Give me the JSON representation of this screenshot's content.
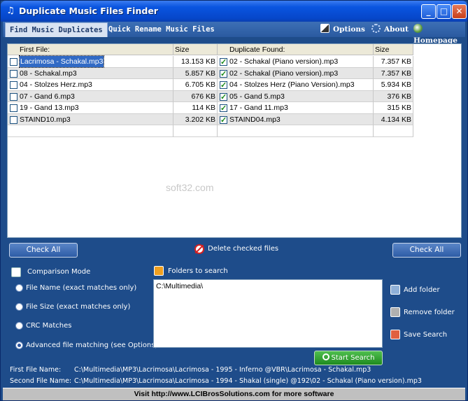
{
  "window": {
    "title": "Duplicate Music Files Finder",
    "controls": [
      "_",
      "□",
      "✕"
    ]
  },
  "tabs": [
    {
      "label": "Find Music Duplicates",
      "active": true
    },
    {
      "label": "Quick Rename Music Files",
      "active": false
    }
  ],
  "menu": {
    "options": "Options",
    "about": "About",
    "homepage": "Homepage"
  },
  "grid": {
    "columns": [
      "First File:",
      "Size",
      "Duplicate Found:",
      "Size"
    ],
    "rows": [
      {
        "first": "Lacrimosa - Schakal.mp3",
        "first_size": "13.153 KB",
        "first_checked": false,
        "dup": "02 - Schakal (Piano version).mp3",
        "dup_size": "7.357 KB",
        "dup_checked": true
      },
      {
        "first": "08 - Schakal.mp3",
        "first_size": "5.857 KB",
        "first_checked": false,
        "dup": "02 - Schakal (Piano version).mp3",
        "dup_size": "7.357 KB",
        "dup_checked": true
      },
      {
        "first": "04 - Stolzes Herz.mp3",
        "first_size": "6.705 KB",
        "first_checked": false,
        "dup": "04 - Stolzes Herz (Piano Version).mp3",
        "dup_size": "5.934 KB",
        "dup_checked": true
      },
      {
        "first": "07 - Gand 6.mp3",
        "first_size": "676 KB",
        "first_checked": false,
        "dup": "05 - Gand 5.mp3",
        "dup_size": "376 KB",
        "dup_checked": true
      },
      {
        "first": "19 - Gand 13.mp3",
        "first_size": "114 KB",
        "first_checked": false,
        "dup": "17 - Gand 11.mp3",
        "dup_size": "315 KB",
        "dup_checked": true
      },
      {
        "first": "STAIND10.mp3",
        "first_size": "3.202 KB",
        "first_checked": false,
        "dup": "STAIND04.mp3",
        "dup_size": "4.134 KB",
        "dup_checked": true
      }
    ],
    "watermark": "soft32.com"
  },
  "actions": {
    "check_all_left": "Check All",
    "delete_checked": "Delete checked files",
    "check_all_right": "Check All"
  },
  "comparison": {
    "title": "Comparison Mode",
    "options": [
      {
        "label": "File Name (exact matches only)",
        "selected": false
      },
      {
        "label": "File Size (exact matches only)",
        "selected": false
      },
      {
        "label": "CRC Matches",
        "selected": false
      },
      {
        "label": "Advanced file matching (see Options)",
        "selected": true
      }
    ]
  },
  "folders": {
    "title": "Folders to search",
    "value": "C:\\Multimedia\\"
  },
  "side_actions": {
    "add_folder": "Add folder",
    "remove_folder": "Remove folder",
    "save_search": "Save Search"
  },
  "start_search": "Start Search",
  "info": {
    "first_label": "First File Name:",
    "first_value": "C:\\Multimedia\\MP3\\Lacrimosa\\Lacrimosa - 1995 - Inferno @VBR\\Lacrimosa - Schakal.mp3",
    "second_label": "Second File Name:",
    "second_value": "C:\\Multimedia\\MP3\\Lacrimosa\\Lacrimosa - 1994 - Shakal (single) @192\\02 - Schakal (Piano version).mp3"
  },
  "footer": "Visit http://www.LCIBrosSolutions.com for more software",
  "colors": {
    "window_bg": "#1e4c8a",
    "titlebar": "#0a55e0",
    "accent_green": "#1e8a1e",
    "delete_red": "#d62020"
  }
}
